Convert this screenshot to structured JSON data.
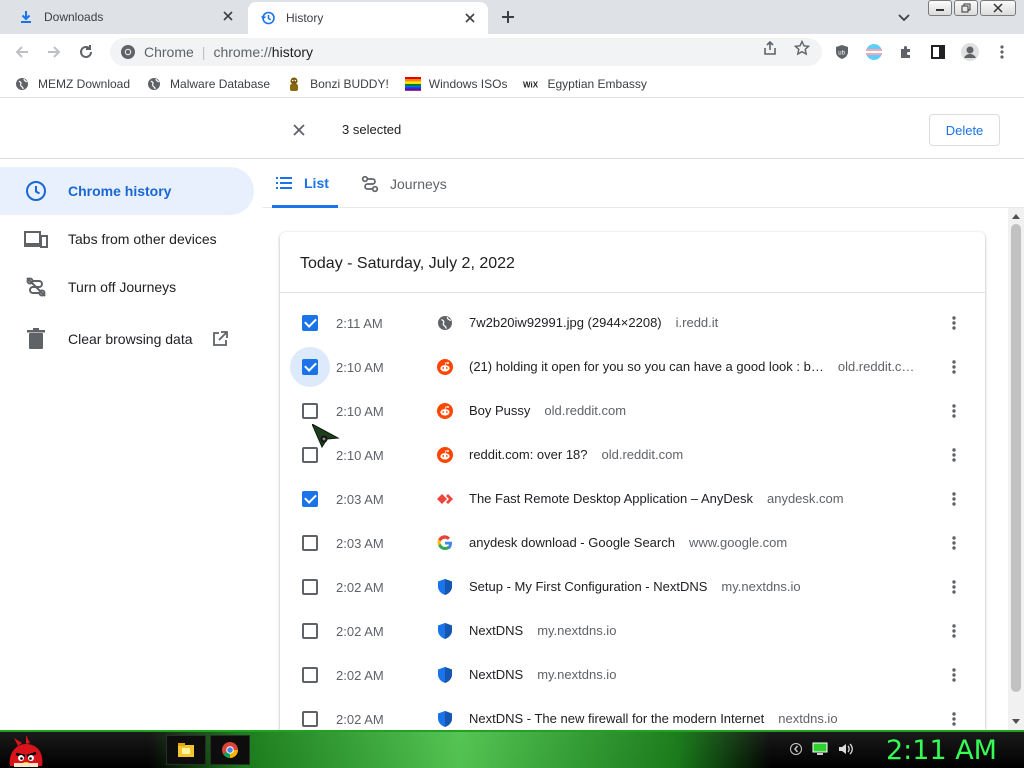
{
  "tabs": [
    {
      "label": "Downloads",
      "icon": "download-icon"
    },
    {
      "label": "History",
      "icon": "history-icon"
    }
  ],
  "omnibox": {
    "site_name": "Chrome",
    "url_scheme": "chrome://",
    "url_path": "history"
  },
  "bookmarks": [
    {
      "label": "MEMZ Download",
      "icon": "globe-icon"
    },
    {
      "label": "Malware Database",
      "icon": "globe-icon"
    },
    {
      "label": "Bonzi BUDDY!",
      "icon": "bonzi-icon"
    },
    {
      "label": "Windows ISOs",
      "icon": "windows-flag-icon"
    },
    {
      "label": "Egyptian Embassy",
      "icon": "wix-icon"
    }
  ],
  "selection": {
    "count_label": "3 selected",
    "delete_label": "Delete"
  },
  "sidebar": {
    "items": [
      {
        "label": "Chrome history",
        "icon": "clock-icon"
      },
      {
        "label": "Tabs from other devices",
        "icon": "devices-icon"
      },
      {
        "label": "Turn off Journeys",
        "icon": "journeys-off-icon"
      },
      {
        "label": "Clear browsing data",
        "icon": "trash-icon"
      }
    ]
  },
  "subtabs": {
    "list": "List",
    "journeys": "Journeys"
  },
  "history": {
    "day_label": "Today - Saturday, July 2, 2022",
    "rows": [
      {
        "checked": true,
        "time": "2:11 AM",
        "favicon": "globe-icon",
        "title": "7w2b20iw92991.jpg (2944×2208)",
        "domain": "i.redd.it"
      },
      {
        "checked": true,
        "time": "2:10 AM",
        "favicon": "reddit-icon",
        "title": "(21) holding it open for you so you can have a good look  : b…",
        "domain": "old.reddit.c…"
      },
      {
        "checked": false,
        "time": "2:10 AM",
        "favicon": "reddit-icon",
        "title": "Boy Pussy",
        "domain": "old.reddit.com"
      },
      {
        "checked": false,
        "time": "2:10 AM",
        "favicon": "reddit-icon",
        "title": "reddit.com: over 18?",
        "domain": "old.reddit.com"
      },
      {
        "checked": true,
        "time": "2:03 AM",
        "favicon": "anydesk-icon",
        "title": "The Fast Remote Desktop Application – AnyDesk",
        "domain": "anydesk.com"
      },
      {
        "checked": false,
        "time": "2:03 AM",
        "favicon": "google-icon",
        "title": "anydesk download - Google Search",
        "domain": "www.google.com"
      },
      {
        "checked": false,
        "time": "2:02 AM",
        "favicon": "nextdns-shield-icon",
        "title": "Setup - My First Configuration - NextDNS",
        "domain": "my.nextdns.io"
      },
      {
        "checked": false,
        "time": "2:02 AM",
        "favicon": "nextdns-shield-icon",
        "title": "NextDNS",
        "domain": "my.nextdns.io"
      },
      {
        "checked": false,
        "time": "2:02 AM",
        "favicon": "nextdns-shield-icon",
        "title": "NextDNS",
        "domain": "my.nextdns.io"
      },
      {
        "checked": false,
        "time": "2:02 AM",
        "favicon": "nextdns-shield-icon",
        "title": "NextDNS - The new firewall for the modern Internet",
        "domain": "nextdns.io"
      }
    ]
  },
  "taskbar": {
    "clock": "2:11 AM"
  },
  "colors": {
    "accent": "#1a73e8",
    "selected_bg": "#e8f0fe",
    "reddit": "#ff4500",
    "anydesk": "#ef443b",
    "nextdns": "#1a73e8",
    "taskbar_green": "#33ff55"
  }
}
